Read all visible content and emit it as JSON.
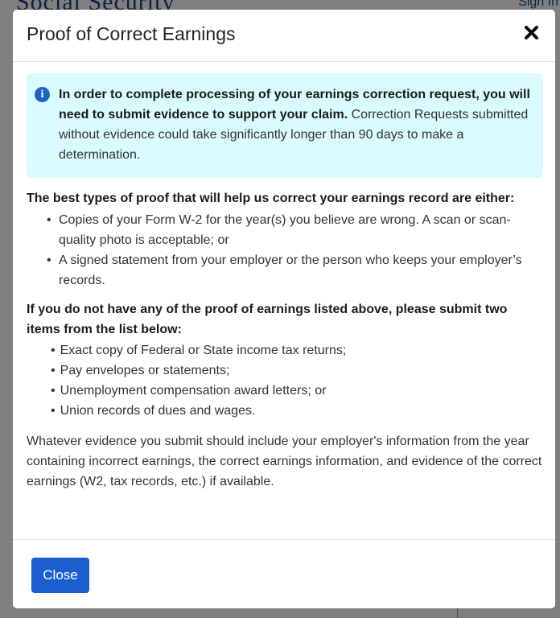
{
  "background": {
    "site_title": "Social Security",
    "sign_in": "Sign In"
  },
  "modal": {
    "title": "Proof of Correct Earnings",
    "close_icon": "close-icon",
    "alert": {
      "icon": "info-icon",
      "bold_text": "In order to complete processing of your earnings correction request, you will need to submit evidence to support your claim.",
      "text": "Correction Requests submitted without evidence could take significantly longer than 90 days to make a determination."
    },
    "best_proof": {
      "heading": "The best types of proof  that will help us correct your earnings record are either:",
      "items": [
        "Copies of your Form W-2 for the year(s) you believe are wrong. A scan or scan-quality photo is acceptable; or",
        "A signed statement from your employer or the person who keeps your employer’s records."
      ]
    },
    "alternative_proof": {
      "heading": "If you do not have any of the proof of earnings listed above, please submit two items from the list below:",
      "items": [
        "Exact copy of Federal or State income tax returns;",
        "Pay envelopes or statements;",
        "Unemployment compensation award letters; or",
        "Union records of dues and wages."
      ]
    },
    "closing_text": "Whatever evidence you submit should include your employer's information from the year containing incorrect earnings, the correct earnings information, and evidence of the correct earnings (W2, tax records, etc.) if available.",
    "close_button_label": "Close"
  },
  "colors": {
    "alert_background": "#dafbfd",
    "primary_button": "#1a5ed0",
    "info_icon": "#1d63c4"
  }
}
